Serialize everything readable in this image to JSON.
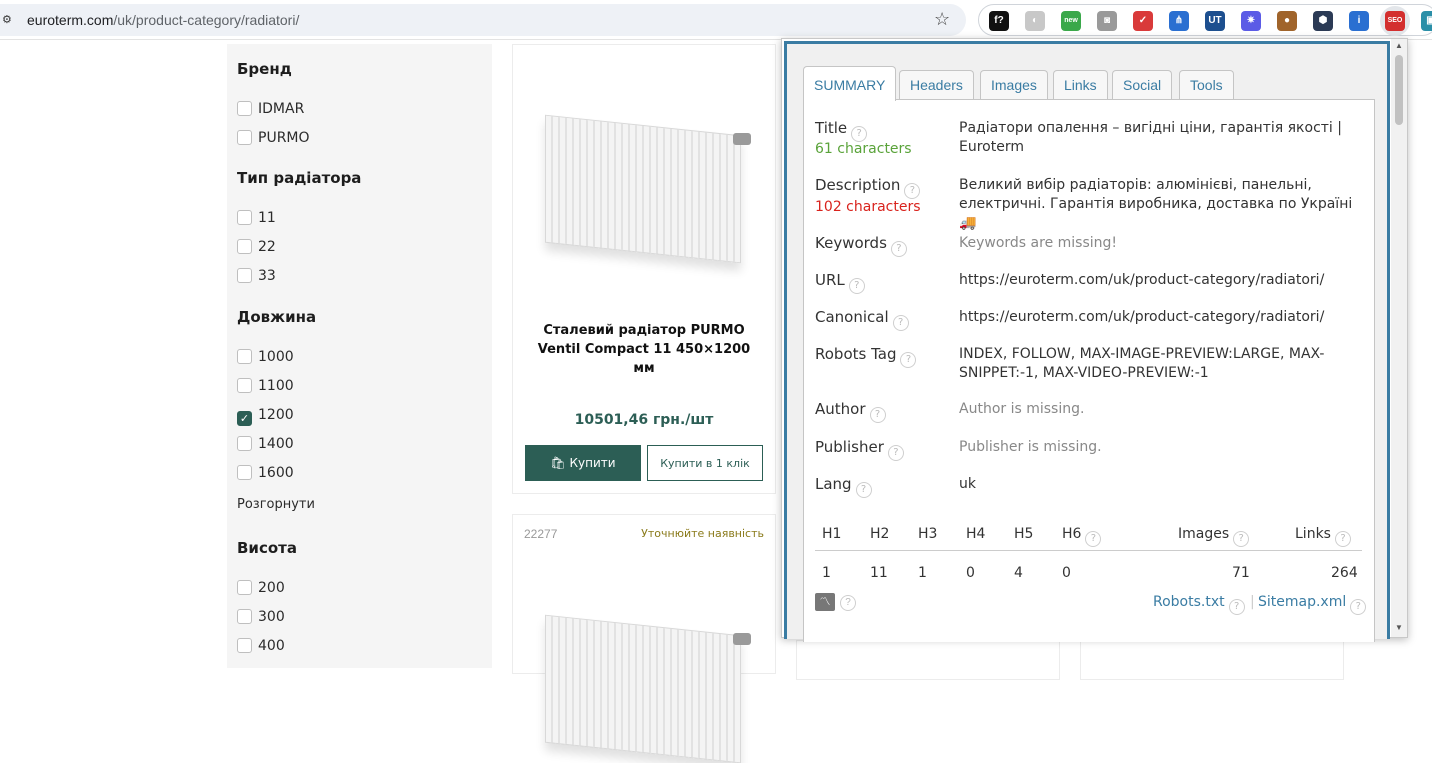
{
  "browser": {
    "url_host": "euroterm.com",
    "url_path": "/uk/product-category/radiatori/",
    "extensions": [
      {
        "name": "f-question-icon",
        "glyph": "f?",
        "color": "#111111"
      },
      {
        "name": "moon-icon",
        "glyph": "◐",
        "color": "#c8c8c8"
      },
      {
        "name": "new-extension-icon",
        "glyph": "new",
        "color": "#3aa84a"
      },
      {
        "name": "camera-icon",
        "glyph": "◙",
        "color": "#9a9a9a"
      },
      {
        "name": "checkbox-ext-icon",
        "glyph": "✓",
        "color": "#d93a3a"
      },
      {
        "name": "fork-icon",
        "glyph": "⋔",
        "color": "#2a6fd1"
      },
      {
        "name": "ut-icon",
        "glyph": "UT",
        "color": "#1d4f8f"
      },
      {
        "name": "gear-ext-icon",
        "glyph": "✷",
        "color": "#5b5be6"
      },
      {
        "name": "cookie-icon",
        "glyph": "●",
        "color": "#a0642b"
      },
      {
        "name": "hex-icon",
        "glyph": "⬢",
        "color": "#2b3a55"
      },
      {
        "name": "seo-badge-icon",
        "glyph": "i",
        "color": "#2a6fd1"
      },
      {
        "name": "seo-extension-icon",
        "glyph": "SEO",
        "color": "#d32f2f"
      },
      {
        "name": "puzzle-icon",
        "glyph": "▣",
        "color": "#2a8fa8"
      }
    ]
  },
  "filters": {
    "brand": {
      "title": "Бренд",
      "items": [
        "IDMAR",
        "PURMO"
      ]
    },
    "type": {
      "title": "Тип радіатора",
      "items": [
        "11",
        "22",
        "33"
      ]
    },
    "length": {
      "title": "Довжина",
      "items": [
        "1000",
        "1100",
        "1200",
        "1400",
        "1600"
      ],
      "checked": "1200"
    },
    "expand_label": "Розгорнути",
    "height": {
      "title": "Висота",
      "items": [
        "200",
        "300",
        "400"
      ]
    }
  },
  "product": {
    "name": "Сталевий радіатор PURMO Ventil Compact 11 450×1200 мм",
    "price": "10501,46 грн./шт",
    "buy_label": "Купити",
    "oneclick_label": "Купити в 1 клік"
  },
  "product2": {
    "code": "22277",
    "availability": "Уточнюйте наявність"
  },
  "seo": {
    "tabs": [
      "SUMMARY",
      "Headers",
      "Images",
      "Links",
      "Social",
      "Tools"
    ],
    "title_label": "Title",
    "title_count": "61 characters",
    "title_value": "Радіатори опалення – вигідні ціни, гарантія якості | Euroterm",
    "description_label": "Description",
    "description_count": "102 characters",
    "description_value": "Великий вибір радіаторів: алюмінієві, панельні, електричні. Гарантія виробника, доставка по Україні 🚚",
    "keywords_label": "Keywords",
    "keywords_value": "Keywords are missing!",
    "url_label": "URL",
    "url_value": "https://euroterm.com/uk/product-category/radiatori/",
    "canonical_label": "Canonical",
    "canonical_value": "https://euroterm.com/uk/product-category/radiatori/",
    "robots_label": "Robots Tag",
    "robots_value": "INDEX, FOLLOW, MAX-IMAGE-PREVIEW:LARGE, MAX-SNIPPET:-1, MAX-VIDEO-PREVIEW:-1",
    "author_label": "Author",
    "author_value": "Author is missing.",
    "publisher_label": "Publisher",
    "publisher_value": "Publisher is missing.",
    "lang_label": "Lang",
    "lang_value": "uk",
    "headings": {
      "h1_label": "H1",
      "h2_label": "H2",
      "h3_label": "H3",
      "h4_label": "H4",
      "h5_label": "H5",
      "h6_label": "H6",
      "images_label": "Images",
      "links_label": "Links",
      "h1": "1",
      "h2": "11",
      "h3": "1",
      "h4": "0",
      "h5": "4",
      "h6": "0",
      "images": "71",
      "links": "264"
    },
    "robots_txt_label": "Robots.txt",
    "sitemap_label": "Sitemap.xml",
    "help_glyph": "?"
  }
}
